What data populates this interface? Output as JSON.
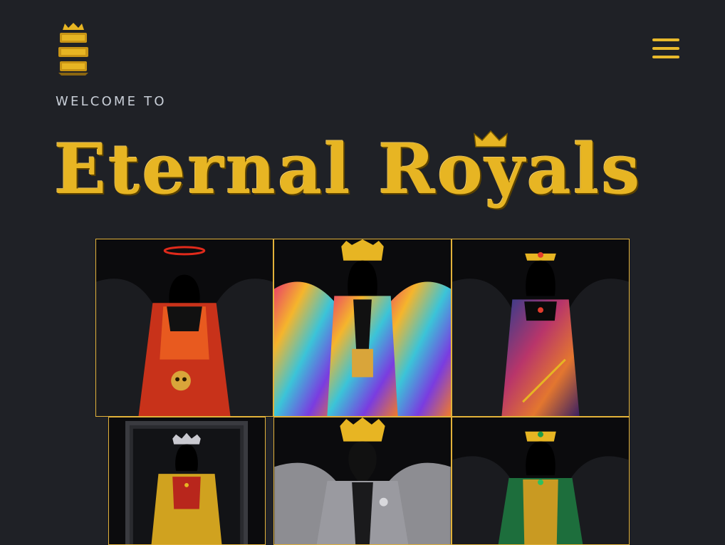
{
  "header": {
    "logo_icon": "eternal-royals-crest-icon",
    "menu_icon": "hamburger-menu-icon"
  },
  "hero": {
    "welcome": "WELCOME TO",
    "title": "Eternal Royals"
  },
  "colors": {
    "background": "#1f2126",
    "gold": "#e7b523",
    "welcome_text": "#c9cfd8",
    "tile_border": "#e2b23a"
  },
  "gallery": {
    "items": [
      {
        "name": "royal-red-halo",
        "crown": "halo",
        "robe": "red-orange"
      },
      {
        "name": "royal-rainbow-crown",
        "crown": "crown",
        "robe": "rainbow"
      },
      {
        "name": "royal-galaxy-queen",
        "crown": "tiara",
        "robe": "galaxy"
      },
      {
        "name": "royal-framed-queen",
        "crown": "tiara",
        "robe": "gold-red"
      },
      {
        "name": "royal-plague-king",
        "crown": "crown",
        "robe": "grey-suit"
      },
      {
        "name": "royal-emerald-queen",
        "crown": "tiara",
        "robe": "green-gold"
      }
    ]
  }
}
